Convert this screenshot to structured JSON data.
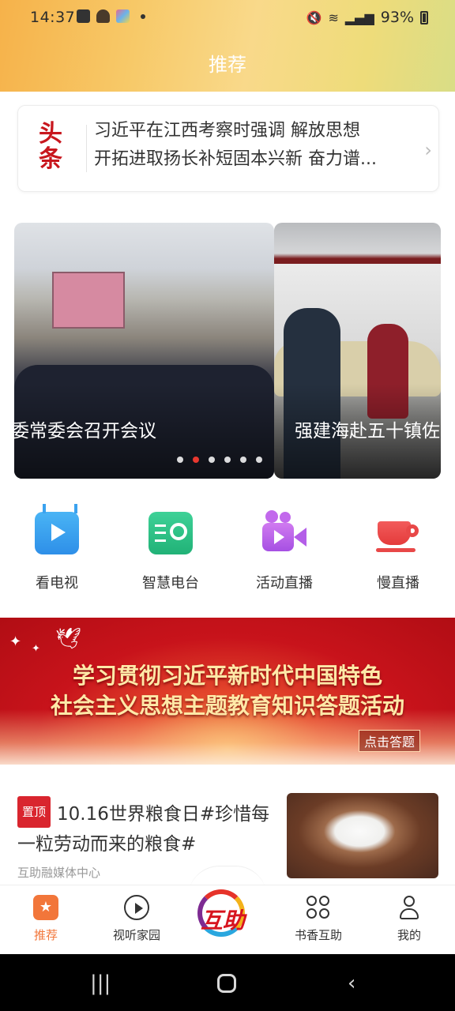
{
  "status_bar": {
    "time": "14:37",
    "battery": "93%"
  },
  "header": {
    "title": "推荐"
  },
  "headline": {
    "logo_top": "头",
    "logo_bottom": "条",
    "line1": "习近平在江西考察时强调  解放思想",
    "line2": "开拓进取扬长补短固本兴新  奋力谱..."
  },
  "carousel": {
    "slides": [
      {
        "caption": "委常委会召开会议"
      },
      {
        "caption": "强建海赴五十镇佐"
      }
    ],
    "dot_count": 6,
    "active_index": 1
  },
  "quick_links": [
    {
      "label": "看电视",
      "icon": "tv-play-icon"
    },
    {
      "label": "智慧电台",
      "icon": "radio-icon"
    },
    {
      "label": "活动直播",
      "icon": "video-camera-icon"
    },
    {
      "label": "慢直播",
      "icon": "cup-icon"
    }
  ],
  "banner": {
    "line1": "学习贯彻习近平新时代中国特色",
    "line2": "社会主义思想主题教育知识答题活动",
    "button": "点击答题"
  },
  "news": {
    "badge": "置顶",
    "title": "10.16世界粮食日#珍惜每一粒劳动而来的粮食#",
    "source": "互助融媒体中心"
  },
  "bottom_nav": {
    "items": [
      {
        "label": "推荐",
        "icon": "star-icon",
        "active": true
      },
      {
        "label": "视听家园",
        "icon": "cloud-play-icon",
        "active": false
      },
      {
        "label": "书香互助",
        "icon": "grid-icon",
        "active": false
      },
      {
        "label": "我的",
        "icon": "user-icon",
        "active": false
      }
    ],
    "center_logo": "互助"
  },
  "colors": {
    "accent": "#f2763a",
    "headline_red": "#c8171e",
    "pin_red": "#d9252e"
  }
}
